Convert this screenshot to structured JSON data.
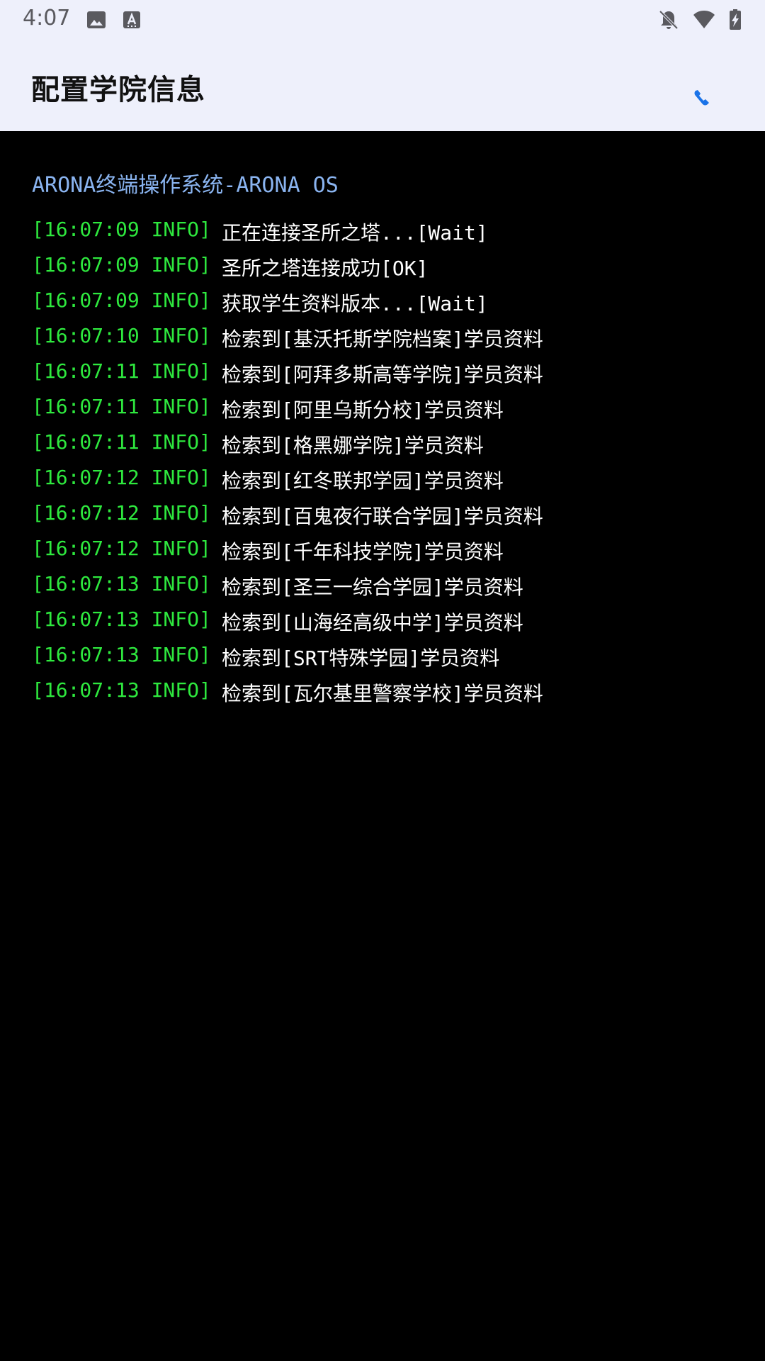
{
  "status_bar": {
    "time": "4:07",
    "icons": [
      "image-icon",
      "text-a-icon",
      "bell-off-icon",
      "wifi-icon",
      "battery-charging-icon"
    ]
  },
  "app_bar": {
    "title": "配置学院信息",
    "action_icon": "phone-icon",
    "accent_color": "#1a73e8"
  },
  "terminal": {
    "header": "ARONA终端操作系统-ARONA OS",
    "logs": [
      {
        "ts": "[16:07:09 INFO]",
        "msg": "正在连接圣所之塔...[Wait]"
      },
      {
        "ts": "[16:07:09 INFO]",
        "msg": "圣所之塔连接成功[OK]"
      },
      {
        "ts": "[16:07:09 INFO]",
        "msg": "获取学生资料版本...[Wait]"
      },
      {
        "ts": "[16:07:10 INFO]",
        "msg": "检索到[基沃托斯学院档案]学员资料"
      },
      {
        "ts": "[16:07:11 INFO]",
        "msg": "检索到[阿拜多斯高等学院]学员资料"
      },
      {
        "ts": "[16:07:11 INFO]",
        "msg": "检索到[阿里乌斯分校]学员资料"
      },
      {
        "ts": "[16:07:11 INFO]",
        "msg": "检索到[格黑娜学院]学员资料"
      },
      {
        "ts": "[16:07:12 INFO]",
        "msg": "检索到[红冬联邦学园]学员资料"
      },
      {
        "ts": "[16:07:12 INFO]",
        "msg": "检索到[百鬼夜行联合学园]学员资料"
      },
      {
        "ts": "[16:07:12 INFO]",
        "msg": "检索到[千年科技学院]学员资料"
      },
      {
        "ts": "[16:07:13 INFO]",
        "msg": "检索到[圣三一综合学园]学员资料"
      },
      {
        "ts": "[16:07:13 INFO]",
        "msg": "检索到[山海经高级中学]学员资料"
      },
      {
        "ts": "[16:07:13 INFO]",
        "msg": "检索到[SRT特殊学园]学员资料"
      },
      {
        "ts": "[16:07:13 INFO]",
        "msg": "检索到[瓦尔基里警察学校]学员资料"
      }
    ],
    "colors": {
      "timestamp": "#2ee83e",
      "message": "#ffffff",
      "header": "#8ab4f0"
    }
  }
}
